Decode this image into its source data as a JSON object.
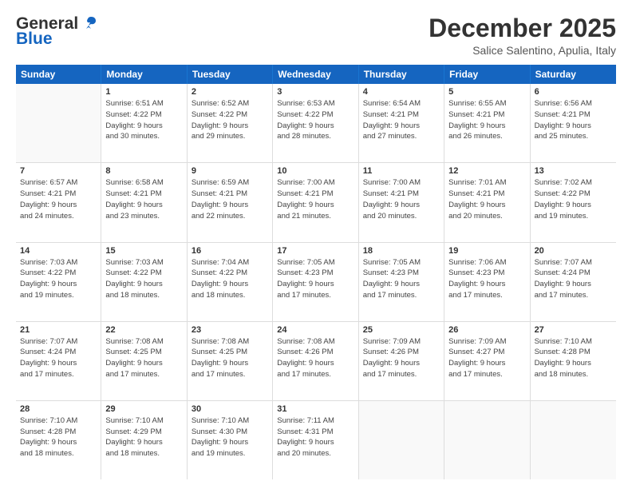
{
  "logo": {
    "text1": "General",
    "text2": "Blue"
  },
  "header": {
    "title": "December 2025",
    "subtitle": "Salice Salentino, Apulia, Italy"
  },
  "weekdays": [
    "Sunday",
    "Monday",
    "Tuesday",
    "Wednesday",
    "Thursday",
    "Friday",
    "Saturday"
  ],
  "weeks": [
    [
      {
        "day": "",
        "info": ""
      },
      {
        "day": "1",
        "info": "Sunrise: 6:51 AM\nSunset: 4:22 PM\nDaylight: 9 hours\nand 30 minutes."
      },
      {
        "day": "2",
        "info": "Sunrise: 6:52 AM\nSunset: 4:22 PM\nDaylight: 9 hours\nand 29 minutes."
      },
      {
        "day": "3",
        "info": "Sunrise: 6:53 AM\nSunset: 4:22 PM\nDaylight: 9 hours\nand 28 minutes."
      },
      {
        "day": "4",
        "info": "Sunrise: 6:54 AM\nSunset: 4:21 PM\nDaylight: 9 hours\nand 27 minutes."
      },
      {
        "day": "5",
        "info": "Sunrise: 6:55 AM\nSunset: 4:21 PM\nDaylight: 9 hours\nand 26 minutes."
      },
      {
        "day": "6",
        "info": "Sunrise: 6:56 AM\nSunset: 4:21 PM\nDaylight: 9 hours\nand 25 minutes."
      }
    ],
    [
      {
        "day": "7",
        "info": "Sunrise: 6:57 AM\nSunset: 4:21 PM\nDaylight: 9 hours\nand 24 minutes."
      },
      {
        "day": "8",
        "info": "Sunrise: 6:58 AM\nSunset: 4:21 PM\nDaylight: 9 hours\nand 23 minutes."
      },
      {
        "day": "9",
        "info": "Sunrise: 6:59 AM\nSunset: 4:21 PM\nDaylight: 9 hours\nand 22 minutes."
      },
      {
        "day": "10",
        "info": "Sunrise: 7:00 AM\nSunset: 4:21 PM\nDaylight: 9 hours\nand 21 minutes."
      },
      {
        "day": "11",
        "info": "Sunrise: 7:00 AM\nSunset: 4:21 PM\nDaylight: 9 hours\nand 20 minutes."
      },
      {
        "day": "12",
        "info": "Sunrise: 7:01 AM\nSunset: 4:21 PM\nDaylight: 9 hours\nand 20 minutes."
      },
      {
        "day": "13",
        "info": "Sunrise: 7:02 AM\nSunset: 4:22 PM\nDaylight: 9 hours\nand 19 minutes."
      }
    ],
    [
      {
        "day": "14",
        "info": "Sunrise: 7:03 AM\nSunset: 4:22 PM\nDaylight: 9 hours\nand 19 minutes."
      },
      {
        "day": "15",
        "info": "Sunrise: 7:03 AM\nSunset: 4:22 PM\nDaylight: 9 hours\nand 18 minutes."
      },
      {
        "day": "16",
        "info": "Sunrise: 7:04 AM\nSunset: 4:22 PM\nDaylight: 9 hours\nand 18 minutes."
      },
      {
        "day": "17",
        "info": "Sunrise: 7:05 AM\nSunset: 4:23 PM\nDaylight: 9 hours\nand 17 minutes."
      },
      {
        "day": "18",
        "info": "Sunrise: 7:05 AM\nSunset: 4:23 PM\nDaylight: 9 hours\nand 17 minutes."
      },
      {
        "day": "19",
        "info": "Sunrise: 7:06 AM\nSunset: 4:23 PM\nDaylight: 9 hours\nand 17 minutes."
      },
      {
        "day": "20",
        "info": "Sunrise: 7:07 AM\nSunset: 4:24 PM\nDaylight: 9 hours\nand 17 minutes."
      }
    ],
    [
      {
        "day": "21",
        "info": "Sunrise: 7:07 AM\nSunset: 4:24 PM\nDaylight: 9 hours\nand 17 minutes."
      },
      {
        "day": "22",
        "info": "Sunrise: 7:08 AM\nSunset: 4:25 PM\nDaylight: 9 hours\nand 17 minutes."
      },
      {
        "day": "23",
        "info": "Sunrise: 7:08 AM\nSunset: 4:25 PM\nDaylight: 9 hours\nand 17 minutes."
      },
      {
        "day": "24",
        "info": "Sunrise: 7:08 AM\nSunset: 4:26 PM\nDaylight: 9 hours\nand 17 minutes."
      },
      {
        "day": "25",
        "info": "Sunrise: 7:09 AM\nSunset: 4:26 PM\nDaylight: 9 hours\nand 17 minutes."
      },
      {
        "day": "26",
        "info": "Sunrise: 7:09 AM\nSunset: 4:27 PM\nDaylight: 9 hours\nand 17 minutes."
      },
      {
        "day": "27",
        "info": "Sunrise: 7:10 AM\nSunset: 4:28 PM\nDaylight: 9 hours\nand 18 minutes."
      }
    ],
    [
      {
        "day": "28",
        "info": "Sunrise: 7:10 AM\nSunset: 4:28 PM\nDaylight: 9 hours\nand 18 minutes."
      },
      {
        "day": "29",
        "info": "Sunrise: 7:10 AM\nSunset: 4:29 PM\nDaylight: 9 hours\nand 18 minutes."
      },
      {
        "day": "30",
        "info": "Sunrise: 7:10 AM\nSunset: 4:30 PM\nDaylight: 9 hours\nand 19 minutes."
      },
      {
        "day": "31",
        "info": "Sunrise: 7:11 AM\nSunset: 4:31 PM\nDaylight: 9 hours\nand 20 minutes."
      },
      {
        "day": "",
        "info": ""
      },
      {
        "day": "",
        "info": ""
      },
      {
        "day": "",
        "info": ""
      }
    ]
  ]
}
